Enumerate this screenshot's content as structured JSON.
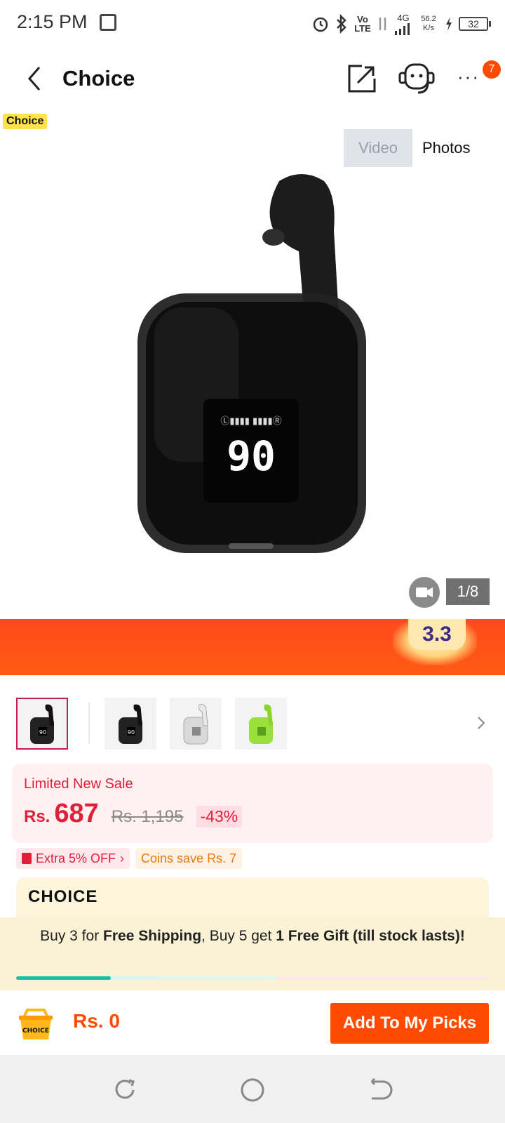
{
  "status_bar": {
    "time": "2:15 PM",
    "volte": "Vo LTE",
    "network": "4G",
    "speed": "56.2 K/s",
    "battery": "32"
  },
  "header": {
    "title": "Choice",
    "notification_count": "7"
  },
  "gallery": {
    "choice_tag": "Choice",
    "tabs": [
      "Video",
      "Photos"
    ],
    "active_tab": "Photos",
    "counter": "1/8"
  },
  "promo": {
    "badge": "3.3",
    "colors": {
      "banner": "#ff4a1a",
      "accent": "#ffe9b0"
    }
  },
  "thumbnails": [
    {
      "color": "black",
      "selected": true
    },
    {
      "color": "black",
      "selected": false
    },
    {
      "color": "white",
      "selected": false
    },
    {
      "color": "green",
      "selected": false
    }
  ],
  "price": {
    "sale_label": "Limited New Sale",
    "currency": "Rs.",
    "current": "687",
    "original": "Rs. 1,195",
    "discount": "-43%"
  },
  "coupons": {
    "extra_off": "Extra 5% OFF",
    "coins": "Coins save Rs. 7"
  },
  "choice_card": {
    "logo": "CHOICE"
  },
  "shipping": {
    "text_a": "Buy 3 for ",
    "text_b": "Free Shipping",
    "text_c": ", Buy 5 get ",
    "text_d": "1 Free Gift (till stock lasts)!",
    "progress": 0.2
  },
  "bottom_bar": {
    "cart_label": "CHOICE",
    "cart_total": "Rs. 0",
    "add_button": "Add To My Picks"
  },
  "colors": {
    "brand_orange": "#ff4a00",
    "price_red": "#e0203a",
    "progress_teal": "#14c2a5"
  }
}
